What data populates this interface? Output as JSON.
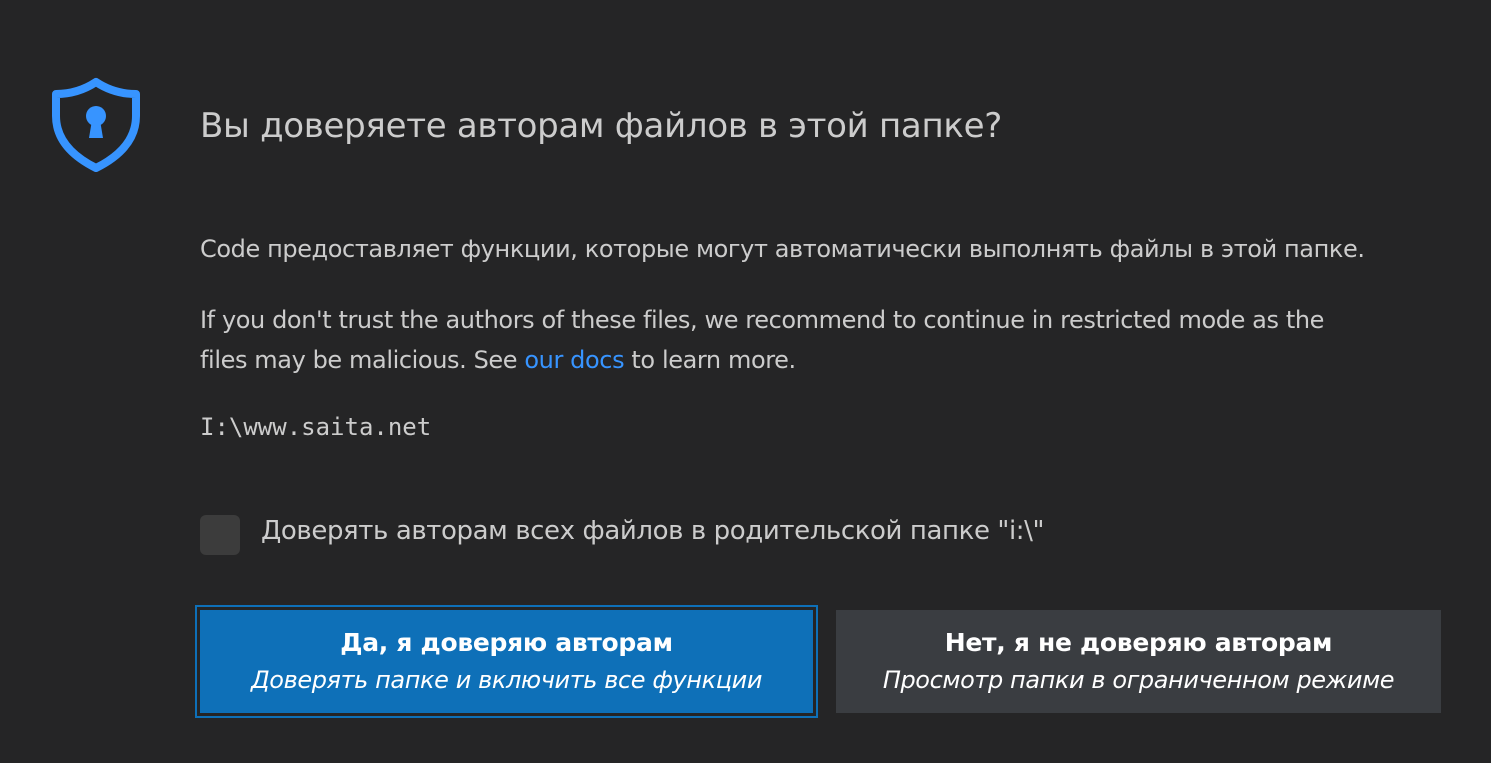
{
  "accent_color": "#3794ff",
  "icon": "shield-keyhole-icon",
  "title": "Вы доверяете авторам файлов в этой папке?",
  "paragraph1": "Code предоставляет функции, которые могут автоматически выполнять файлы в этой папке.",
  "paragraph2": {
    "before": "If you don't trust the authors of these files, we recommend to continue in restricted mode as the",
    "line2_before": "files may be malicious. See ",
    "link": "our docs",
    "after": " to learn more."
  },
  "folder_path": "I:\\www.saita.net",
  "checkbox": {
    "label": "Доверять авторам всех файлов в родительской папке \"i:\\\"",
    "checked": false
  },
  "buttons": {
    "trust": {
      "title": "Да, я доверяю авторам",
      "subtitle": "Доверять папке и включить все функции"
    },
    "dont_trust": {
      "title": "Нет, я не доверяю авторам",
      "subtitle": "Просмотр папки в ограниченном режиме"
    }
  }
}
